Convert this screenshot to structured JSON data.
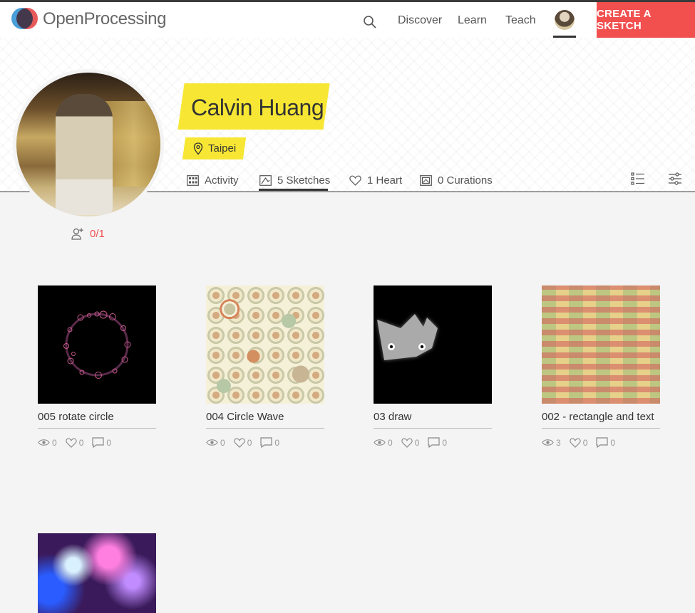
{
  "nav": {
    "logo_text": "OpenProcessing",
    "links": [
      "Discover",
      "Learn",
      "Teach"
    ],
    "create_label": "CREATE A SKETCH"
  },
  "profile": {
    "name": "Calvin Huang",
    "location": "Taipei",
    "follow": "0/1"
  },
  "tabs": [
    {
      "label": "Activity",
      "icon": "activity-icon"
    },
    {
      "label": "5 Sketches",
      "icon": "sketches-icon",
      "active": true
    },
    {
      "label": "1 Heart",
      "icon": "heart-icon"
    },
    {
      "label": "0 Curations",
      "icon": "curations-icon"
    }
  ],
  "sketches": [
    {
      "title": "005 rotate circle",
      "views": "0",
      "hearts": "0",
      "comments": "0"
    },
    {
      "title": "004 Circle Wave",
      "views": "0",
      "hearts": "0",
      "comments": "0"
    },
    {
      "title": "03 draw",
      "views": "0",
      "hearts": "0",
      "comments": "0"
    },
    {
      "title": "002 - rectangle and text",
      "views": "3",
      "hearts": "0",
      "comments": "0"
    },
    {
      "title": "",
      "views": "",
      "hearts": "",
      "comments": ""
    }
  ],
  "colors": {
    "accent": "#f24f4f",
    "highlight": "#f7e734"
  }
}
